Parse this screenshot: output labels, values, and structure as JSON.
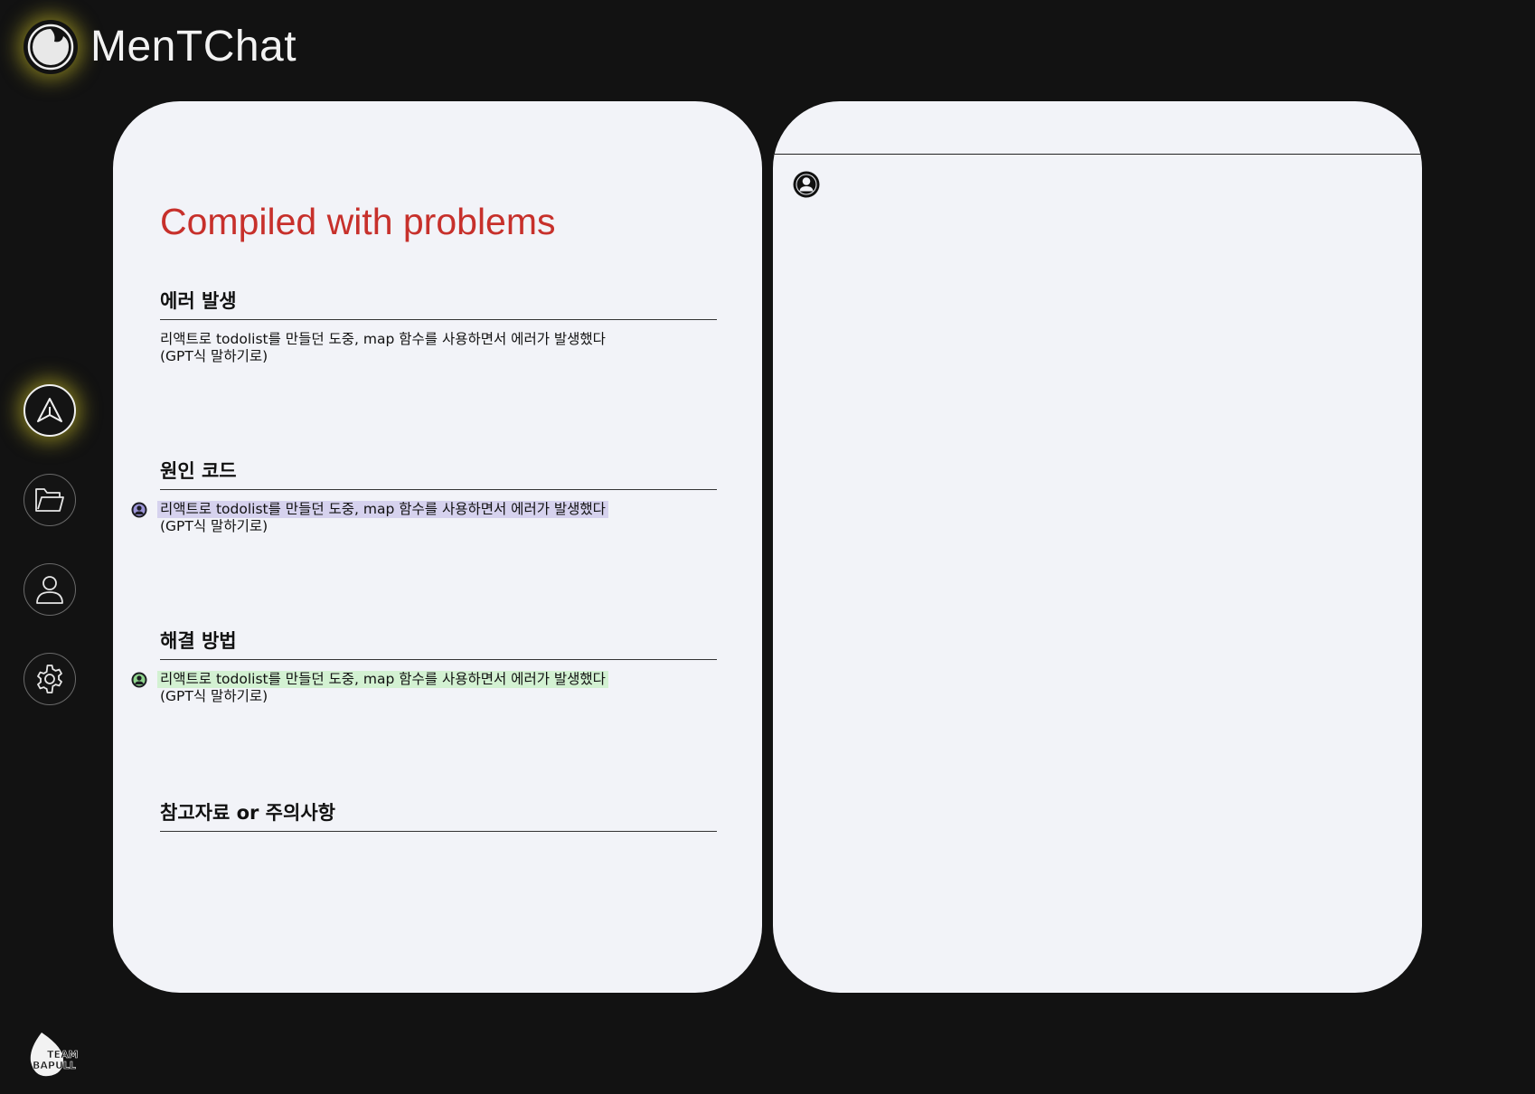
{
  "app": {
    "title": "MenTChat",
    "accent_glow": "#d6c828",
    "background": "#121212"
  },
  "sidebar": {
    "items": [
      {
        "name": "send",
        "icon": "paper-plane-icon",
        "active": true
      },
      {
        "name": "folder",
        "icon": "folder-icon",
        "active": false
      },
      {
        "name": "profile",
        "icon": "user-icon",
        "active": false
      },
      {
        "name": "settings",
        "icon": "gear-icon",
        "active": false
      }
    ]
  },
  "document": {
    "title": "Compiled with problems",
    "title_color": "#c7302b",
    "sections": [
      {
        "heading": "에러 발생",
        "line1": "리액트로 todolist를 만들던 도중, map 함수를 사용하면서 에러가 발생했다",
        "line2": "(GPT식 말하기로)"
      },
      {
        "heading": "원인 코드",
        "line1": "리액트로 todolist를 만들던 도중, map 함수를 사용하면서 에러가 발생했다",
        "line2": "(GPT식 말하기로)",
        "highlight": "#d6d2ee"
      },
      {
        "heading": "해결 방법",
        "line1": "리액트로 todolist를 만들던 도중, map 함수를 사용하면서 에러가 발생했다",
        "line2": "(GPT식 말하기로)",
        "highlight": "#d3f1d2"
      },
      {
        "heading": "참고자료 or 주의사항"
      }
    ]
  },
  "team_logo": {
    "text_top": "TEAM.",
    "text_bottom": "BAPULL"
  }
}
